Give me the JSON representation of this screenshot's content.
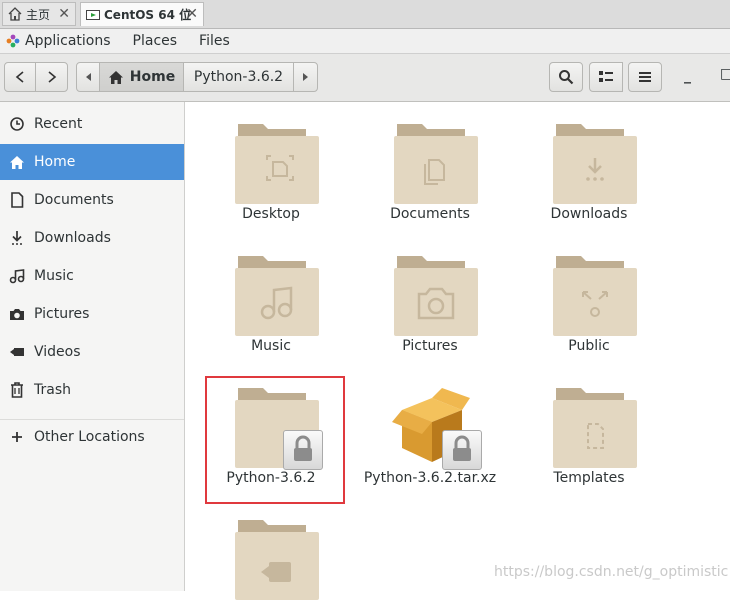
{
  "tabs": [
    {
      "label": "主页"
    },
    {
      "label": "CentOS 64 位"
    }
  ],
  "top_panel": {
    "applications": "Applications",
    "places": "Places",
    "files": "Files"
  },
  "pathbar": {
    "home": "Home",
    "current": "Python-3.6.2"
  },
  "sidebar": {
    "items": [
      {
        "label": "Recent",
        "icon": "clock-icon"
      },
      {
        "label": "Home",
        "icon": "home-icon",
        "active": true
      },
      {
        "label": "Documents",
        "icon": "document-icon"
      },
      {
        "label": "Downloads",
        "icon": "download-icon"
      },
      {
        "label": "Music",
        "icon": "music-icon"
      },
      {
        "label": "Pictures",
        "icon": "camera-icon"
      },
      {
        "label": "Videos",
        "icon": "video-icon"
      },
      {
        "label": "Trash",
        "icon": "trash-icon"
      },
      {
        "label": "Other Locations",
        "icon": "plus-icon"
      }
    ]
  },
  "files": [
    {
      "label": "Desktop",
      "icon": "folder-desktop-icon"
    },
    {
      "label": "Documents",
      "icon": "folder-documents-icon"
    },
    {
      "label": "Downloads",
      "icon": "folder-downloads-icon"
    },
    {
      "label": "Music",
      "icon": "folder-music-icon"
    },
    {
      "label": "Pictures",
      "icon": "folder-pictures-icon"
    },
    {
      "label": "Public",
      "icon": "folder-public-icon"
    },
    {
      "label": "Python-3.6.2",
      "icon": "folder-locked-icon",
      "highlighted": true
    },
    {
      "label": "Python-3.6.2.tar.xz",
      "icon": "archive-locked-icon"
    },
    {
      "label": "Templates",
      "icon": "folder-templates-icon"
    },
    {
      "label": "",
      "icon": "folder-videos-icon"
    }
  ],
  "watermark": "https://blog.csdn.net/g_optimistic",
  "colors": {
    "accent": "#4a90d9",
    "folder": "#e3d7c1",
    "highlight_box": "#e0393e"
  }
}
